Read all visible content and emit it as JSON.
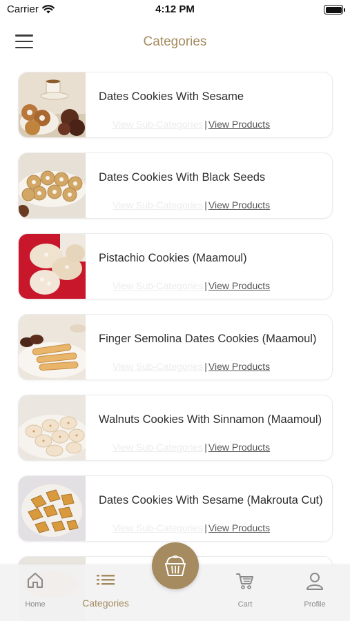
{
  "status_bar": {
    "carrier": "Carrier",
    "time": "4:12 PM"
  },
  "header": {
    "title": "Categories"
  },
  "categories": [
    {
      "name": "Dates Cookies With Sesame",
      "sub_link": "View Sub-Categories",
      "separator": "|",
      "products_link": "View Products"
    },
    {
      "name": "Dates Cookies With Black Seeds",
      "sub_link": "View Sub-Categories",
      "separator": "|",
      "products_link": "View Products"
    },
    {
      "name": "Pistachio Cookies (Maamoul)",
      "sub_link": "View Sub-Categories",
      "separator": "|",
      "products_link": "View Products"
    },
    {
      "name": "Finger Semolina Dates Cookies (Maamoul)",
      "sub_link": "View Sub-Categories",
      "separator": "|",
      "products_link": "View Products"
    },
    {
      "name": "Walnuts Cookies With Sinnamon (Maamoul)",
      "sub_link": "View Sub-Categories",
      "separator": "|",
      "products_link": "View Products"
    },
    {
      "name": "Dates Cookies With Sesame (Makrouta Cut)",
      "sub_link": "View Sub-Categories",
      "separator": "|",
      "products_link": "View Products"
    },
    {
      "name": "",
      "sub_link": "",
      "separator": "",
      "products_link": ""
    }
  ],
  "tab_bar": {
    "home": "Home",
    "categories": "Categories",
    "cart": "Cart",
    "profile": "Profile",
    "center_icon": "cupcake-icon"
  },
  "colors": {
    "accent": "#a58b5f",
    "muted_link": "#ececec",
    "text": "#2e2e2e"
  }
}
